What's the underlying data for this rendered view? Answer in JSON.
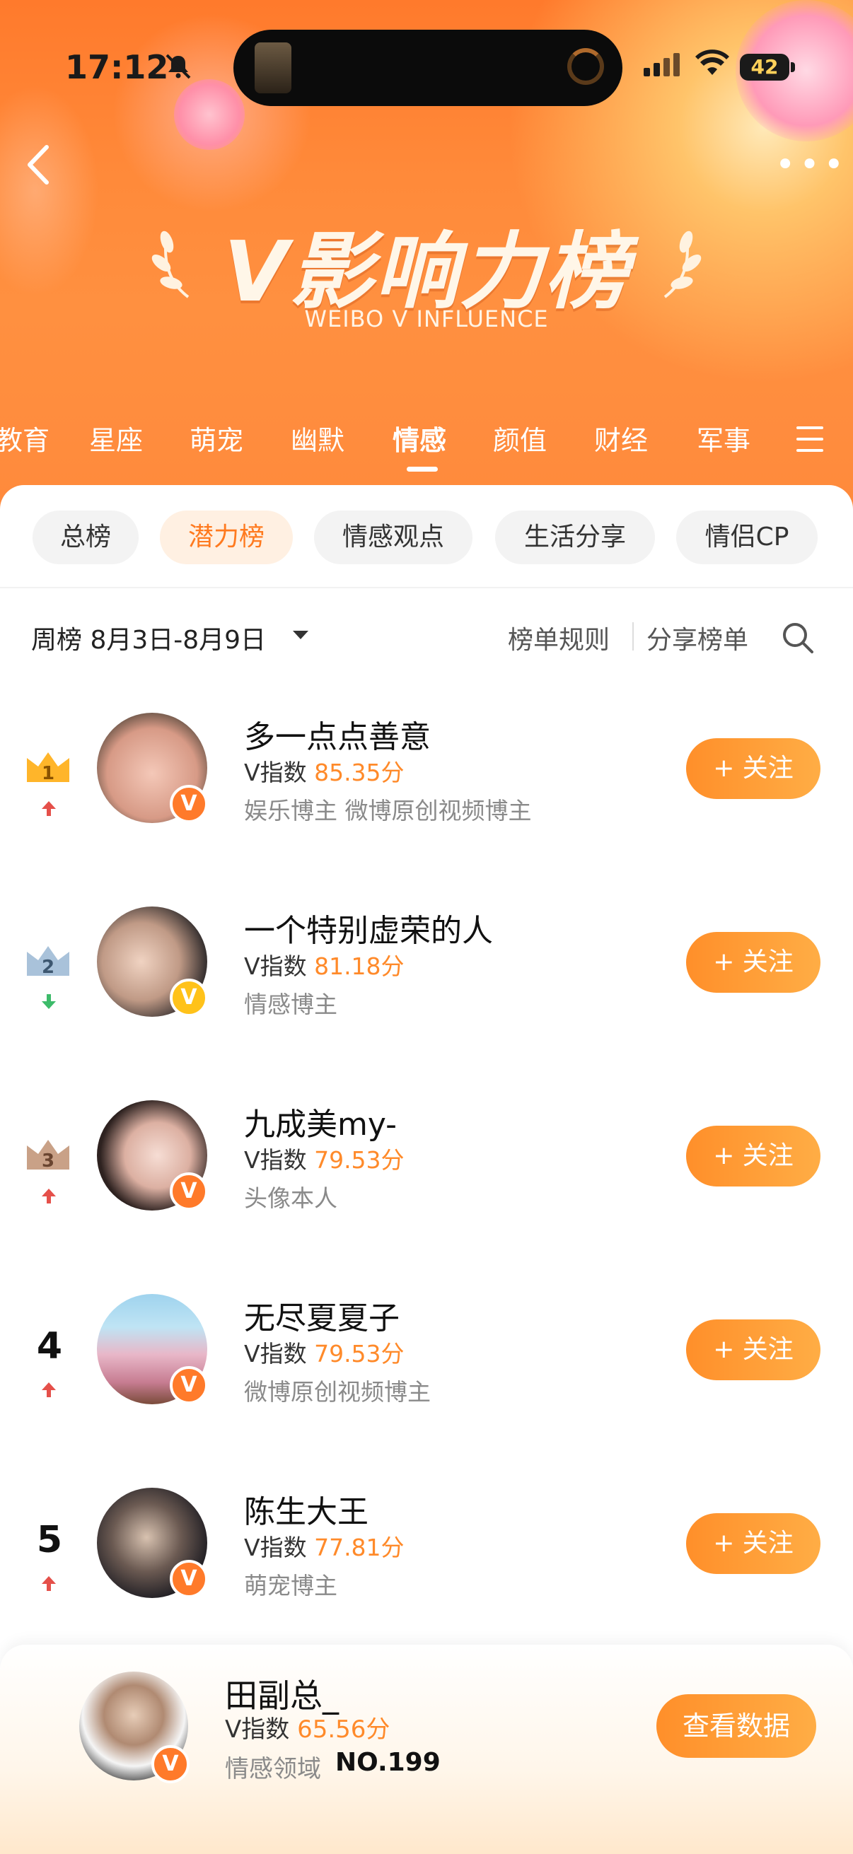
{
  "status_bar": {
    "time": "17:12",
    "battery": "42"
  },
  "header": {
    "title": "V影响力榜",
    "subtitle": "WEIBO V INFLUENCE"
  },
  "categories": [
    "教育",
    "星座",
    "萌宠",
    "幽默",
    "情感",
    "颜值",
    "财经",
    "军事"
  ],
  "active_category": "情感",
  "chips": [
    "总榜",
    "潜力榜",
    "情感观点",
    "生活分享",
    "情侣CP"
  ],
  "active_chip": "潜力榜",
  "period": {
    "label": "周榜 8月3日-8月9日",
    "rules": "榜单规则",
    "share": "分享榜单"
  },
  "follow_label": "+ 关注",
  "entries": [
    {
      "rank": "1",
      "trend": "up",
      "name": "多一点点善意",
      "v_label": "V指数",
      "score": "85.35分",
      "tags": "娱乐博主 微博原创视频博主",
      "badge_color": "#ff7a2a"
    },
    {
      "rank": "2",
      "trend": "down",
      "name": "一个特别虚荣的人",
      "v_label": "V指数",
      "score": "81.18分",
      "tags": "情感博主",
      "badge_color": "#ffc21a"
    },
    {
      "rank": "3",
      "trend": "up",
      "name": "九成美my-",
      "v_label": "V指数",
      "score": "79.53分",
      "tags": "头像本人",
      "badge_color": "#ff7a2a"
    },
    {
      "rank": "4",
      "trend": "up",
      "name": "无尽夏夏子",
      "v_label": "V指数",
      "score": "79.53分",
      "tags": "微博原创视频博主",
      "badge_color": "#ff7a2a"
    },
    {
      "rank": "5",
      "trend": "up",
      "name": "陈生大王",
      "v_label": "V指数",
      "score": "77.81分",
      "tags": "萌宠博主",
      "badge_color": "#ff7a2a"
    }
  ],
  "me": {
    "name": "田副总_",
    "v_label": "V指数",
    "score": "65.56分",
    "domain": "情感领域",
    "rank_no": "NO.199",
    "button": "查看数据"
  },
  "colors": {
    "accent": "#ff7a1f",
    "crown_gold": "#ffb52a",
    "crown_silver": "#a9c2da",
    "crown_bronze": "#c9a187",
    "trend_up": "#e5504a",
    "trend_down": "#3dbb6a"
  }
}
